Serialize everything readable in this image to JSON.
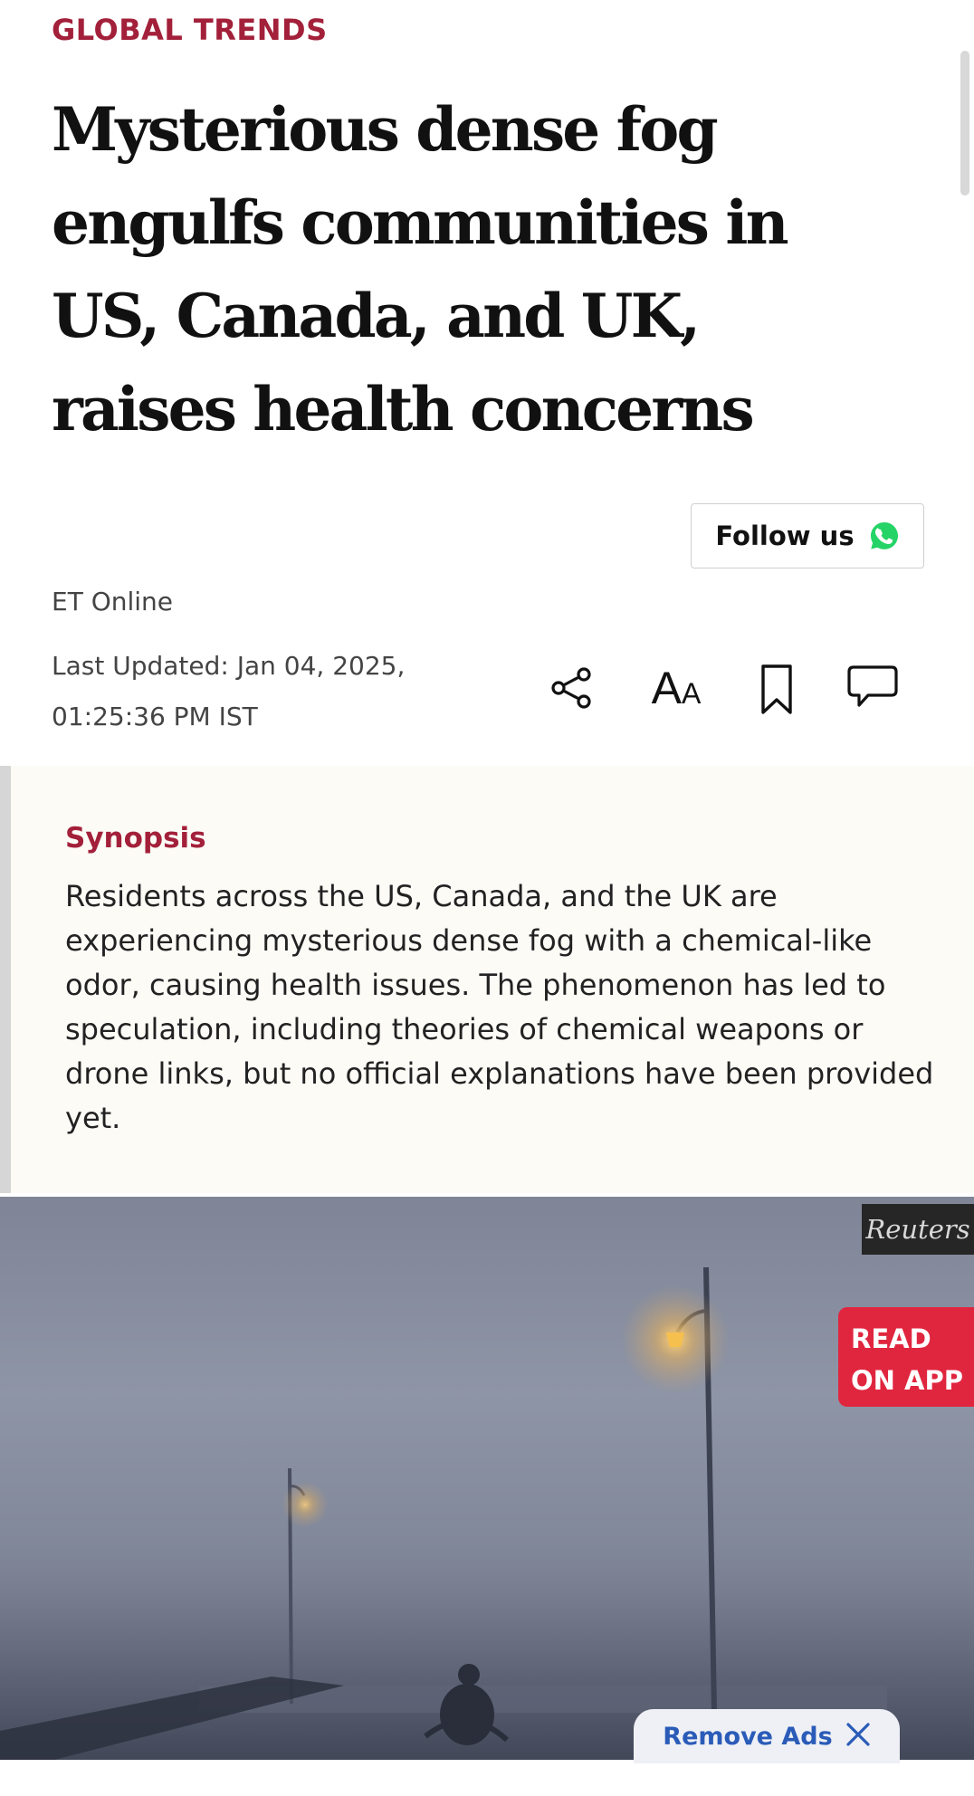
{
  "article": {
    "kicker": "GLOBAL TRENDS",
    "headline": "Mysterious dense fog engulfs communities in US, Canada, and UK, raises health concerns",
    "follow_label": "Follow us",
    "author": "ET Online",
    "updated_line1": "Last Updated: Jan 04, 2025,",
    "updated_line2": "01:25:36 PM IST"
  },
  "toolbar": {
    "icons": [
      "share-icon",
      "font-size-icon",
      "bookmark-icon",
      "comment-icon"
    ],
    "font_size_glyph_large": "A",
    "font_size_glyph_small": "A"
  },
  "synopsis": {
    "title": "Synopsis",
    "text": "Residents across the US, Canada, and the UK are experiencing mysterious dense fog with a chemical-like odor, causing health issues. The phenomenon has led to speculation, including theories of chemical weapons or drone links, but no official explanations have been provided yet."
  },
  "image": {
    "credit": "Reuters"
  },
  "overlays": {
    "read_on_app_line1": "READ",
    "read_on_app_line2": "ON APP",
    "remove_ads": "Remove Ads"
  },
  "colors": {
    "accent": "#a3203a",
    "read_on_app": "#e0263f",
    "whatsapp": "#25d366",
    "remove_ads_text": "#2a5bb8"
  }
}
